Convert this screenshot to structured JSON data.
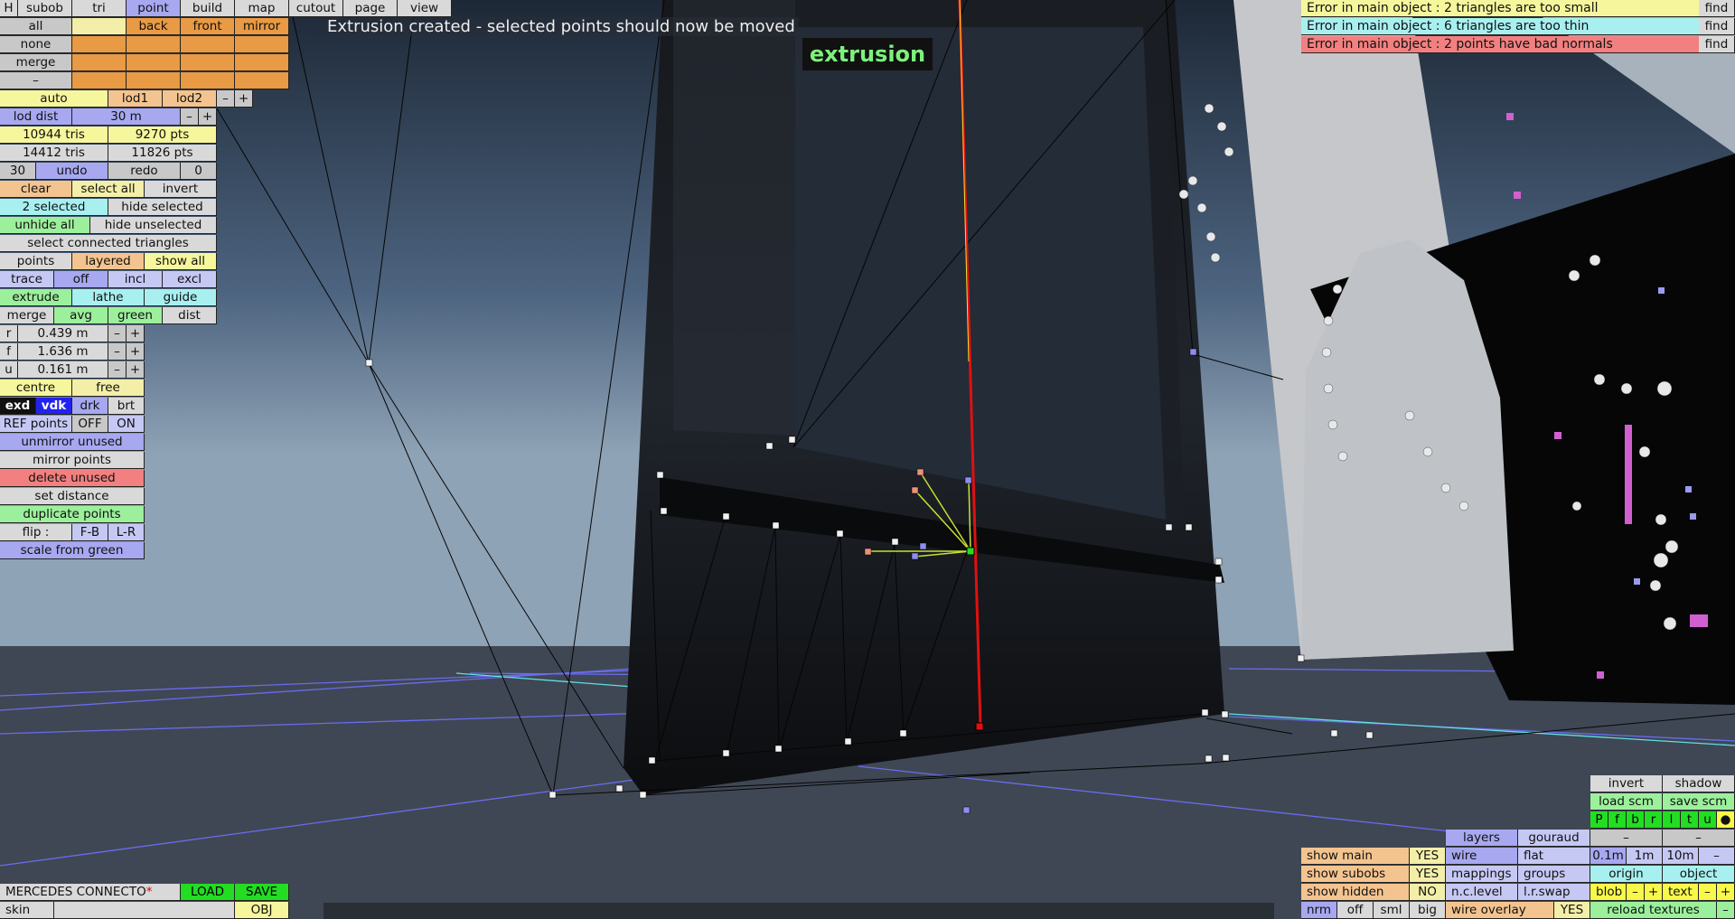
{
  "status_message": "Extrusion created - selected points should now be moved",
  "mode_label": "extrusion",
  "top_menu": [
    "H",
    "subob",
    "tri",
    "point",
    "build",
    "map",
    "cutout",
    "page",
    "view"
  ],
  "view_row1": [
    "all",
    "",
    "back",
    "front",
    "mirror"
  ],
  "view_row2": [
    "none"
  ],
  "view_row3": [
    "merge"
  ],
  "view_row4": [
    "–"
  ],
  "lod": {
    "auto": "auto",
    "lod1": "lod1",
    "lod2": "lod2",
    "minus": "–",
    "plus": "+"
  },
  "lod_dist": {
    "label": "lod dist",
    "value": "30 m",
    "minus": "–",
    "plus": "+"
  },
  "stats": {
    "tris1": "10944 tris",
    "pts1": "9270 pts",
    "tris2": "14412 tris",
    "pts2": "11826 pts"
  },
  "undo_row": {
    "count": "30",
    "undo": "undo",
    "redo": "redo",
    "redo_count": "0"
  },
  "select_row": {
    "clear": "clear",
    "select_all": "select all",
    "invert": "invert"
  },
  "selected_row": {
    "selected": "2 selected",
    "hide_selected": "hide selected"
  },
  "unhide_row": {
    "unhide_all": "unhide all",
    "hide_unselected": "hide unselected"
  },
  "select_connected": "select connected triangles",
  "points_row": {
    "points": "points",
    "layered": "layered",
    "show_all": "show all"
  },
  "trace_row": {
    "trace": "trace",
    "off": "off",
    "incl": "incl",
    "excl": "excl"
  },
  "extrude_row": {
    "extrude": "extrude",
    "lathe": "lathe",
    "guide": "guide"
  },
  "merge_row": {
    "merge": "merge",
    "avg": "avg",
    "green": "green",
    "dist": "dist"
  },
  "coords": [
    {
      "axis": "r",
      "value": "0.439 m",
      "minus": "–",
      "plus": "+"
    },
    {
      "axis": "f",
      "value": "1.636 m",
      "minus": "–",
      "plus": "+"
    },
    {
      "axis": "u",
      "value": "0.161 m",
      "minus": "–",
      "plus": "+"
    }
  ],
  "centre_row": {
    "centre": "centre",
    "free": "free"
  },
  "render_row": {
    "exd": "exd",
    "vdk": "vdk",
    "drk": "drk",
    "brt": "brt"
  },
  "ref_row": {
    "label": "REF points",
    "off": "OFF",
    "on": "ON"
  },
  "actions": {
    "unmirror_unused": "unmirror unused",
    "mirror_points": "mirror points",
    "delete_unused": "delete unused",
    "set_distance": "set distance",
    "duplicate_points": "duplicate points",
    "flip": "flip :",
    "fb": "F-B",
    "lr": "L-R",
    "scale_from_green": "scale from green"
  },
  "errors": [
    {
      "text": "Error in main object : 2 triangles are too small",
      "find": "find",
      "color": "#f6f69c"
    },
    {
      "text": "Error in main object : 6 triangles are too thin",
      "find": "find",
      "color": "#a8f0f0"
    },
    {
      "text": "Error in main object : 2 points have bad normals",
      "find": "find",
      "color": "#f28080"
    }
  ],
  "file": {
    "name": "MERCEDES CONNECTO",
    "modified_mark": "*",
    "load": "LOAD",
    "save": "SAVE",
    "skin": "skin",
    "obj": "OBJ"
  },
  "br": {
    "invert": "invert",
    "shadow": "shadow",
    "load_scm": "load scm",
    "save_scm": "save scm",
    "letters": [
      "P",
      "f",
      "b",
      "r",
      "l",
      "t",
      "u",
      "●"
    ],
    "dash1": "–",
    "dash2": "–",
    "layers": "layers",
    "gouraud": "gouraud",
    "show_main": "show main",
    "show_main_val": "YES",
    "wire": "wire",
    "flat": "flat",
    "d01": "0.1m",
    "d1": "1m",
    "d10": "10m",
    "dminus": "–",
    "show_subobs": "show subobs",
    "show_subobs_val": "YES",
    "mappings": "mappings",
    "groups": "groups",
    "origin": "origin",
    "object": "object",
    "show_hidden": "show hidden",
    "show_hidden_val": "NO",
    "nclevel": "n.c.level",
    "lrswap": "l.r.swap",
    "blob": "blob",
    "blob_minus": "–",
    "blob_plus": "+",
    "text": "text",
    "text_minus": "–",
    "text_plus": "+",
    "nrm": "nrm",
    "off": "off",
    "sml": "sml",
    "big": "big",
    "wire_overlay": "wire overlay",
    "wire_overlay_val": "YES",
    "reload_textures": "reload textures",
    "reload_minus": "–"
  }
}
